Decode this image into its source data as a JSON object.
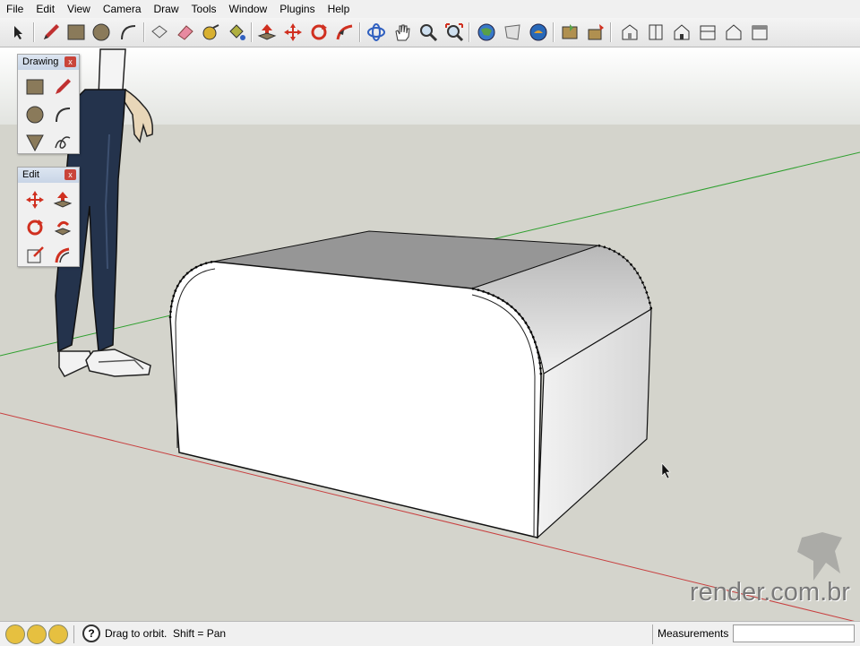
{
  "menu": {
    "items": [
      "File",
      "Edit",
      "View",
      "Camera",
      "Draw",
      "Tools",
      "Window",
      "Plugins",
      "Help"
    ]
  },
  "toolbar": {
    "tools": [
      "select",
      "pencil",
      "rectangle",
      "circle",
      "arc",
      "make-component",
      "eraser",
      "tape-measure",
      "paint-bucket",
      "push-pull",
      "move",
      "rotate",
      "follow-me",
      "orbit",
      "pan",
      "zoom",
      "zoom-extents",
      "get-models",
      "share-model",
      "google-earth",
      "get-photo-texture",
      "add-location",
      "iso-view",
      "top-view",
      "front-view",
      "right-view",
      "back-view",
      "left-view"
    ]
  },
  "palettes": {
    "drawing": {
      "title": "Drawing",
      "close": "x"
    },
    "edit": {
      "title": "Edit",
      "close": "x"
    }
  },
  "watermark": {
    "text": "render.com.br"
  },
  "status": {
    "hint": "Drag to orbit.  Shift = Pan",
    "measurements_label": "Measurements",
    "measurements_value": ""
  },
  "colors": {
    "sky": "#e4e6e2",
    "ground": "#d4d4cc",
    "red_axis": "#c84040",
    "green_axis": "#2fa02f",
    "face_front": "#ffffff",
    "face_top": "#969696",
    "face_right": "#dcdcdc"
  }
}
